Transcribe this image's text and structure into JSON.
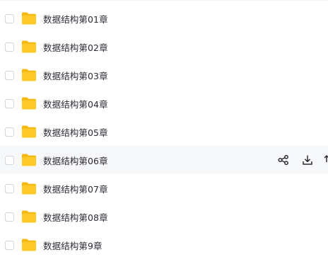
{
  "file_list": {
    "items": [
      {
        "name": "数据结构第01章"
      },
      {
        "name": "数据结构第02章"
      },
      {
        "name": "数据结构第03章"
      },
      {
        "name": "数据结构第04章"
      },
      {
        "name": "数据结构第05章"
      },
      {
        "name": "数据结构第06章"
      },
      {
        "name": "数据结构第07章"
      },
      {
        "name": "数据结构第08章"
      },
      {
        "name": "数据结构第9章"
      }
    ],
    "hovered_index": 5,
    "row_actions": [
      "share-icon",
      "download-icon",
      "upload-icon"
    ]
  },
  "colors": {
    "folder_body": "#ffc928",
    "folder_tab": "#f5b80f",
    "hover_background": "#f7f8fa",
    "text": "#2b2b33"
  }
}
